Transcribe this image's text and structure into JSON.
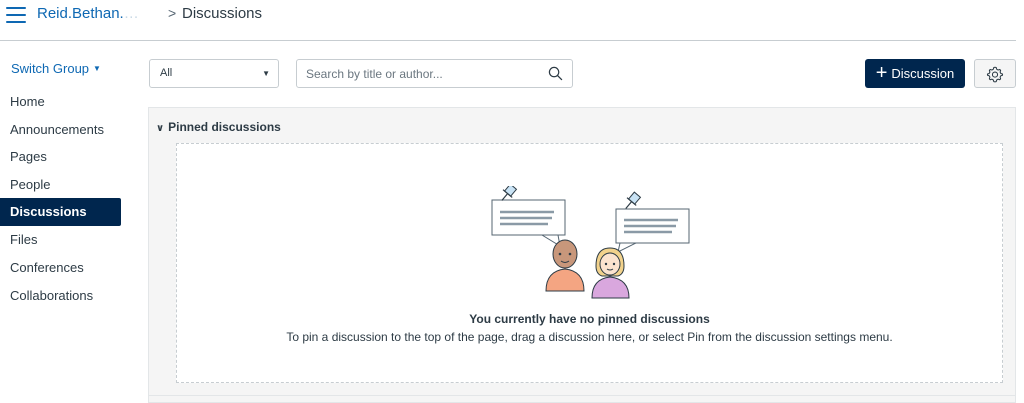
{
  "breadcrumb": {
    "course": "Reid.Bethan.",
    "course_faded": "…",
    "separator": ">",
    "current": "Discussions"
  },
  "sidebar": {
    "switch_group": "Switch Group",
    "switch_group_caret": "▼",
    "items": [
      {
        "label": "Home",
        "active": false
      },
      {
        "label": "Announcements",
        "active": false
      },
      {
        "label": "Pages",
        "active": false
      },
      {
        "label": "People",
        "active": false
      },
      {
        "label": "Discussions",
        "active": true
      },
      {
        "label": "Files",
        "active": false
      },
      {
        "label": "Conferences",
        "active": false
      },
      {
        "label": "Collaborations",
        "active": false
      }
    ]
  },
  "toolbar": {
    "filter_value": "All",
    "filter_arrow": "▼",
    "search_placeholder": "Search by title or author...",
    "add_button_plus": "+",
    "add_button_label": "Discussion"
  },
  "pinned": {
    "chevron": "∨",
    "header": "Pinned discussions",
    "empty_title": "You currently have no pinned discussions",
    "empty_description": "To pin a discussion to the top of the page, drag a discussion here, or select Pin from the discussion settings menu."
  },
  "colors": {
    "brand_dark": "#00264e",
    "link_blue": "#0e68b3",
    "text": "#2d3b45",
    "border": "#c7cdd1"
  },
  "icons": {
    "menu": "hamburger-icon",
    "search": "search-icon",
    "settings": "gear-icon",
    "collapse": "chevron-down-icon"
  }
}
